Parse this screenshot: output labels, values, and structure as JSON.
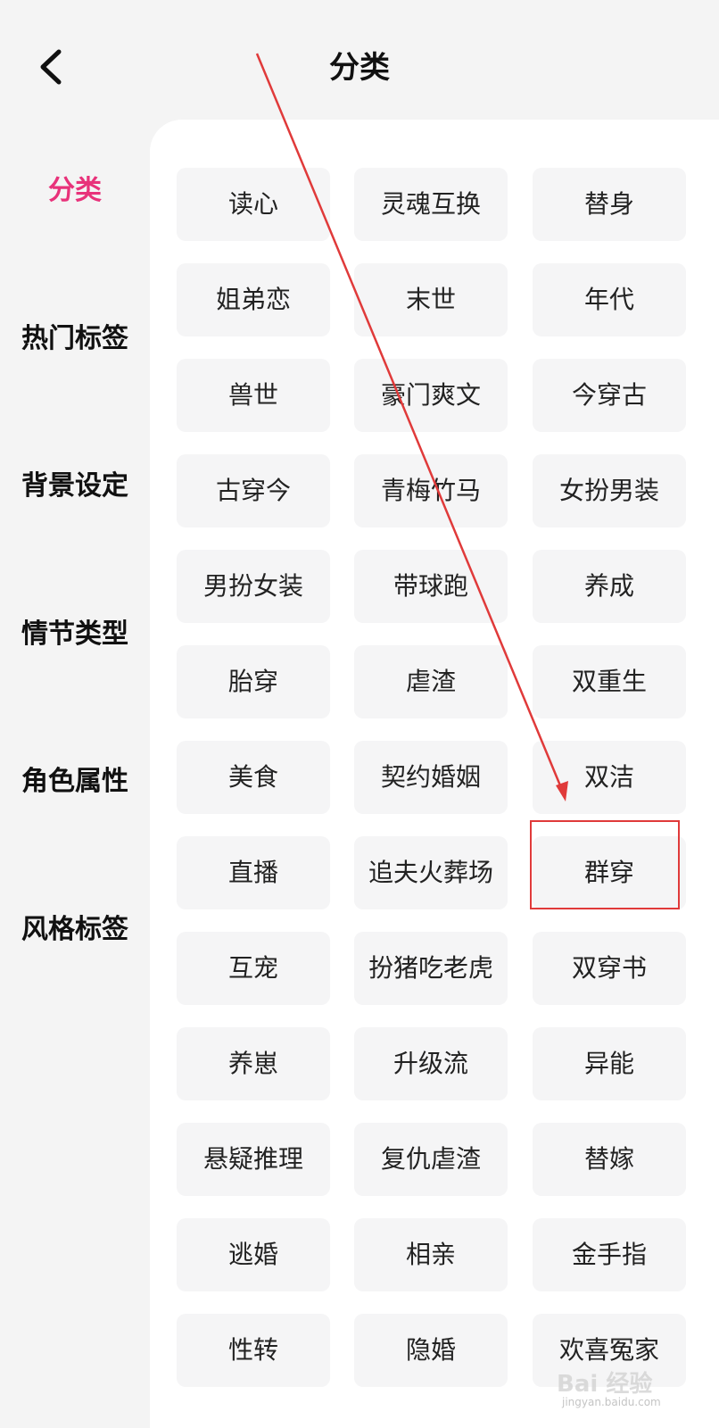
{
  "header": {
    "title": "分类",
    "back_icon": "chevron-left-icon"
  },
  "sidebar": {
    "items": [
      {
        "label": "分类",
        "active": true
      },
      {
        "label": "热门标签",
        "active": false
      },
      {
        "label": "背景设定",
        "active": false
      },
      {
        "label": "情节类型",
        "active": false
      },
      {
        "label": "角色属性",
        "active": false
      },
      {
        "label": "风格标签",
        "active": false
      }
    ]
  },
  "tags": [
    "读心",
    "灵魂互换",
    "替身",
    "姐弟恋",
    "末世",
    "年代",
    "兽世",
    "豪门爽文",
    "今穿古",
    "古穿今",
    "青梅竹马",
    "女扮男装",
    "男扮女装",
    "带球跑",
    "养成",
    "胎穿",
    "虐渣",
    "双重生",
    "美食",
    "契约婚姻",
    "双洁",
    "直播",
    "追夫火葬场",
    "群穿",
    "互宠",
    "扮猪吃老虎",
    "双穿书",
    "养崽",
    "升级流",
    "异能",
    "悬疑推理",
    "复仇虐渣",
    "替嫁",
    "逃婚",
    "相亲",
    "金手指",
    "性转",
    "隐婚",
    "欢喜冤家"
  ],
  "highlighted_tag": "群穿",
  "watermark": {
    "logo": "Bai 经验",
    "url": "jingyan.baidu.com"
  },
  "colors": {
    "accent": "#e8327a",
    "annotation": "#e03a3a",
    "tag_bg": "#f5f5f6",
    "page_bg": "#f4f4f4"
  }
}
